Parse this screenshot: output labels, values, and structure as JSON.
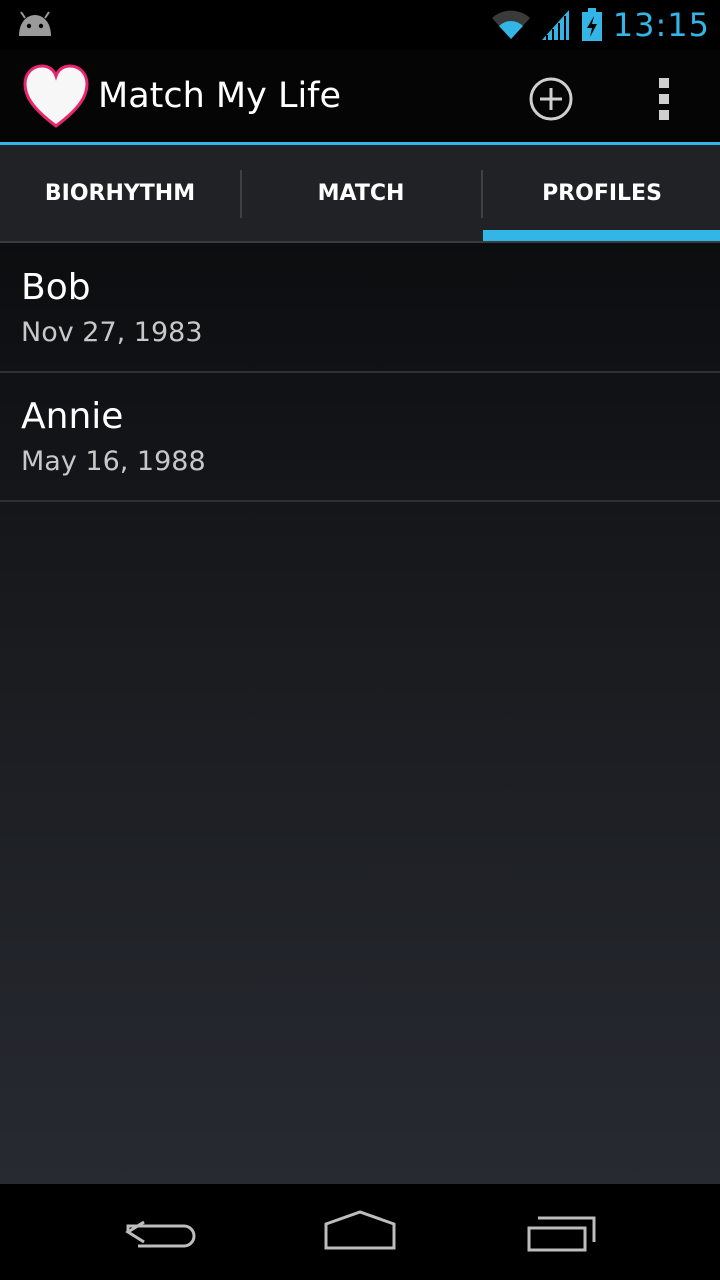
{
  "status_bar": {
    "time": "13:15",
    "icons": [
      "android-debug-icon",
      "wifi-icon",
      "signal-icon",
      "battery-charging-icon"
    ]
  },
  "action_bar": {
    "title": "Match My Life",
    "logo_icon": "heart-icon",
    "actions": [
      "add-icon",
      "overflow-menu-icon"
    ]
  },
  "tabs": [
    {
      "label": "BIORHYTHM",
      "selected": false
    },
    {
      "label": "MATCH",
      "selected": false
    },
    {
      "label": "PROFILES",
      "selected": true
    }
  ],
  "profiles": [
    {
      "name": "Bob",
      "date": "Nov 27, 1983"
    },
    {
      "name": "Annie",
      "date": "May 16, 1988"
    }
  ],
  "nav_bar": {
    "buttons": [
      "back-icon",
      "home-icon",
      "recent-apps-icon"
    ]
  },
  "colors": {
    "accent": "#33b5e5",
    "heart_outline": "#e8266f"
  }
}
